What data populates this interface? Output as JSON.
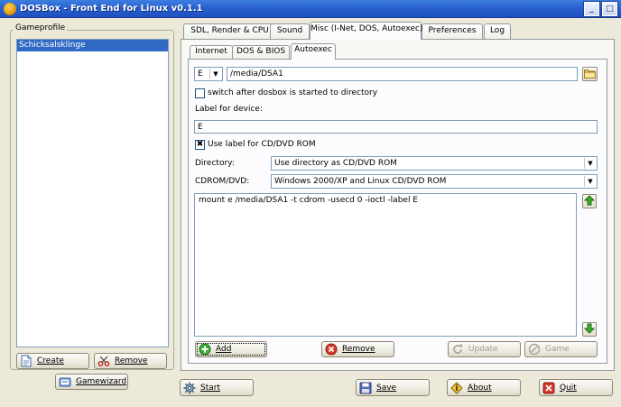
{
  "window": {
    "title": "DOSBox - Front End for Linux v0.1.1",
    "minimize_glyph": "_",
    "maximize_glyph": "□",
    "close_glyph": "×"
  },
  "gameprofile": {
    "title": "Gameprofile",
    "items": [
      "Schicksalsklinge"
    ],
    "create_label": "Create",
    "remove_label": "Remove",
    "gamewizard_label": "Gamewizard"
  },
  "tabs": [
    "SDL, Render & CPU",
    "Sound",
    "Misc (I-Net, DOS, Autoexec)",
    "Preferences",
    "Log"
  ],
  "active_tab": 2,
  "subtabs": [
    "Internet",
    "DOS & BIOS",
    "Autoexec"
  ],
  "active_subtab": 2,
  "autoexec": {
    "drive": "E",
    "path": "/media/DSA1",
    "switch_label": "switch after dosbox is started to directory",
    "switch_checked": false,
    "label_for_device": "Label for device:",
    "device_label_value": "E",
    "use_label_cd": "Use label for CD/DVD ROM",
    "use_label_cd_checked": true,
    "checked_glyph": "✖",
    "directory_label": "Directory:",
    "directory_value": "Use directory as CD/DVD ROM",
    "cdrom_label": "CDROM/DVD:",
    "cdrom_value": "Windows 2000/XP and Linux CD/DVD ROM",
    "commands": "mount e /media/DSA1 -t cdrom -usecd 0 -ioctl -label E",
    "add_label": "Add",
    "remove_label": "Remove",
    "update_label": "Update",
    "game_label": "Game",
    "combo_arrow": "▼"
  },
  "bottom": {
    "start_label": "Start",
    "save_label": "Save",
    "about_label": "About",
    "quit_label": "Quit"
  },
  "colors": {
    "titlebar": "#2a62d0",
    "selection": "#316ac5",
    "window_bg": "#ece9d8"
  }
}
